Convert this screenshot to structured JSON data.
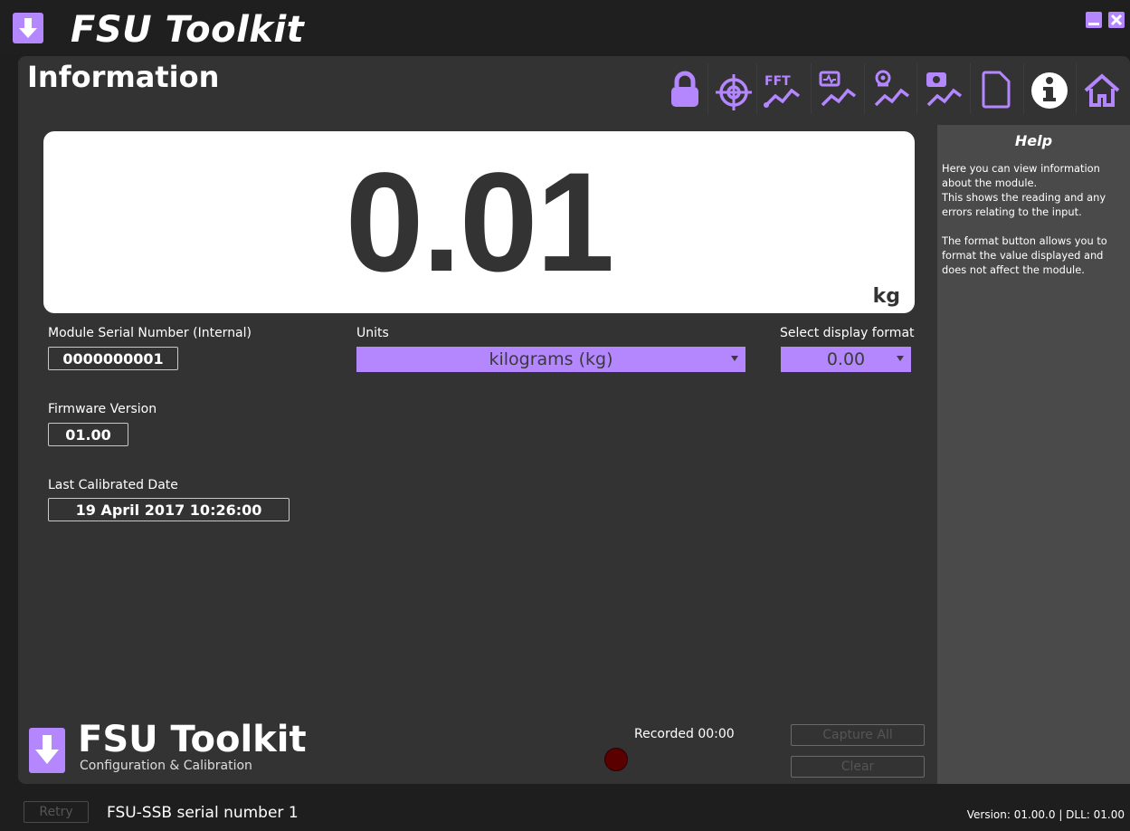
{
  "app": {
    "title": "FSU Toolkit"
  },
  "page": {
    "title": "Information"
  },
  "toolbar": {
    "items": [
      {
        "name": "lock",
        "label": ""
      },
      {
        "name": "target",
        "label": ""
      },
      {
        "name": "fft",
        "label": "FFT"
      },
      {
        "name": "chart-monitor",
        "label": ""
      },
      {
        "name": "chart-zoom",
        "label": ""
      },
      {
        "name": "chart-capture",
        "label": ""
      },
      {
        "name": "document",
        "label": ""
      },
      {
        "name": "info",
        "label": ""
      },
      {
        "name": "home",
        "label": ""
      }
    ],
    "active": "info"
  },
  "display": {
    "reading": "0.01",
    "unit": "kg"
  },
  "fields": {
    "serial_label": "Module Serial Number (Internal)",
    "serial_value": "0000000001",
    "firmware_label": "Firmware Version",
    "firmware_value": "01.00",
    "calibrated_label": "Last Calibrated Date",
    "calibrated_value": "19 April 2017  10:26:00",
    "units_label": "Units",
    "units_value": "kilograms (kg)",
    "format_label": "Select display format",
    "format_value": "0.00"
  },
  "help": {
    "title": "Help",
    "text": "Here you can view information about the module.\nThis shows the reading and any errors relating to the input.\n\nThe format button allows you to format the value displayed and does not affect the module."
  },
  "logo": {
    "title": "FSU Toolkit",
    "subtitle": "Configuration & Calibration"
  },
  "recording": {
    "label": "Recorded 00:00"
  },
  "buttons": {
    "capture_all": "Capture All",
    "clear": "Clear",
    "retry": "Retry"
  },
  "status": {
    "device": "FSU-SSB serial number 1",
    "version": "Version: 01.00.0 | DLL: 01.00"
  },
  "colors": {
    "accent": "#b487ff",
    "panel": "#333333",
    "background": "#1e1e1e"
  }
}
